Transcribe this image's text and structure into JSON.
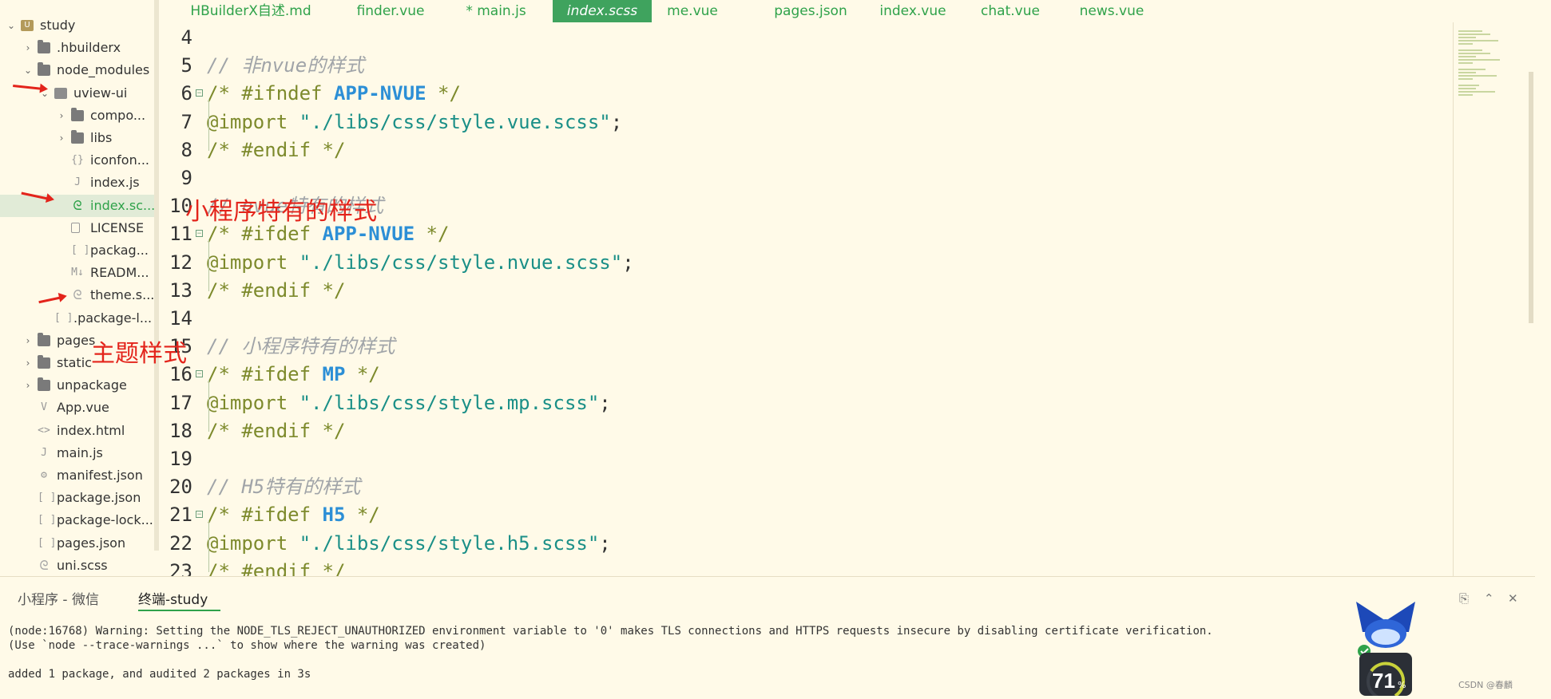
{
  "sidebar": {
    "items": [
      {
        "label": "study",
        "icon": "project-icon",
        "chevron": "⌄"
      },
      {
        "label": ".hbuilderx",
        "icon": "folder-icon",
        "chevron": "›"
      },
      {
        "label": "node_modules",
        "icon": "folder-icon",
        "chevron": "⌄"
      },
      {
        "label": "uview-ui",
        "icon": "folder-open-icon",
        "chevron": "⌄"
      },
      {
        "label": "compo...",
        "icon": "folder-icon",
        "chevron": "›"
      },
      {
        "label": "libs",
        "icon": "folder-icon",
        "chevron": "›"
      },
      {
        "label": "iconfon...",
        "icon": "brace-file-icon"
      },
      {
        "label": "index.js",
        "icon": "js-file-icon"
      },
      {
        "label": "index.sc...",
        "icon": "scss-file-icon"
      },
      {
        "label": "LICENSE",
        "icon": "file-icon"
      },
      {
        "label": "packag...",
        "icon": "json-file-icon"
      },
      {
        "label": "READM...",
        "icon": "markdown-file-icon"
      },
      {
        "label": "theme.s...",
        "icon": "scss-file-icon"
      },
      {
        "label": ".package-l...",
        "icon": "json-file-icon"
      },
      {
        "label": "pages",
        "icon": "folder-icon",
        "chevron": "›"
      },
      {
        "label": "static",
        "icon": "folder-icon",
        "chevron": "›"
      },
      {
        "label": "unpackage",
        "icon": "folder-icon",
        "chevron": "›"
      },
      {
        "label": "App.vue",
        "icon": "vue-file-icon"
      },
      {
        "label": "index.html",
        "icon": "html-file-icon"
      },
      {
        "label": "main.js",
        "icon": "js-file-icon"
      },
      {
        "label": "manifest.json",
        "icon": "gear-file-icon"
      },
      {
        "label": "package.json",
        "icon": "json-file-icon"
      },
      {
        "label": "package-lock....",
        "icon": "json-file-icon"
      },
      {
        "label": "pages.json",
        "icon": "json-file-icon"
      },
      {
        "label": "uni.scss",
        "icon": "scss-file-icon"
      }
    ],
    "selected_index": 8
  },
  "annotations": {
    "miniprogram_style": "小程序特有的样式",
    "theme_style": "主题样式"
  },
  "tabs": [
    "HBuilderX自述.md",
    "finder.vue",
    "* main.js",
    "index.scss",
    "me.vue",
    "pages.json",
    "index.vue",
    "chat.vue",
    "news.vue"
  ],
  "active_tab": "index.scss",
  "editor": {
    "lines": [
      {
        "n": "4"
      },
      {
        "n": "5",
        "comment": "// 非nvue的样式"
      },
      {
        "n": "6",
        "fold": true,
        "pre": "/* #ifndef ",
        "kw": "APP-NVUE",
        "post": " */"
      },
      {
        "n": "7",
        "at": "@import",
        "str": "\"./libs/css/style.vue.scss\"",
        "end": ";"
      },
      {
        "n": "8",
        "pre": "/* #endif */"
      },
      {
        "n": "9"
      },
      {
        "n": "10",
        "comment": "// nvue特有的样式"
      },
      {
        "n": "11",
        "fold": true,
        "pre": "/* #ifdef ",
        "kw": "APP-NVUE",
        "post": " */"
      },
      {
        "n": "12",
        "at": "@import",
        "str": "\"./libs/css/style.nvue.scss\"",
        "end": ";"
      },
      {
        "n": "13",
        "pre": "/* #endif */"
      },
      {
        "n": "14"
      },
      {
        "n": "15",
        "comment": "// 小程序特有的样式"
      },
      {
        "n": "16",
        "fold": true,
        "pre": "/* #ifdef ",
        "kw": "MP",
        "post": " */"
      },
      {
        "n": "17",
        "at": "@import",
        "str": "\"./libs/css/style.mp.scss\"",
        "end": ";"
      },
      {
        "n": "18",
        "pre": "/* #endif */"
      },
      {
        "n": "19"
      },
      {
        "n": "20",
        "comment": "// H5特有的样式"
      },
      {
        "n": "21",
        "fold": true,
        "pre": "/* #ifdef ",
        "kw": "H5",
        "post": " */"
      },
      {
        "n": "22",
        "at": "@import",
        "str": "\"./libs/css/style.h5.scss\"",
        "end": ";"
      },
      {
        "n": "23",
        "pre": "/* #endif */"
      }
    ]
  },
  "panel": {
    "tabs": [
      "小程序 - 微信",
      "终端-study"
    ],
    "active_tab": "终端-study",
    "terminal_lines": [
      "(node:16768) Warning: Setting the NODE_TLS_REJECT_UNAUTHORIZED environment variable to '0' makes TLS connections and HTTPS requests insecure by disabling certificate verification.",
      "(Use `node --trace-warnings ...` to show where the warning was created)",
      "",
      "added 1 package, and audited 2 packages in 3s"
    ],
    "actions": [
      "export-icon",
      "collapse-up-icon",
      "close-panel-icon"
    ]
  },
  "mascot": {
    "percent": "71",
    "unit": "%"
  },
  "watermark": "CSDN @春麟",
  "colors": {
    "accent": "#3fa35e",
    "background": "#fffae8",
    "annotation": "#e3241b",
    "keyword": "#2c8fd6",
    "string": "#1a8f87"
  }
}
